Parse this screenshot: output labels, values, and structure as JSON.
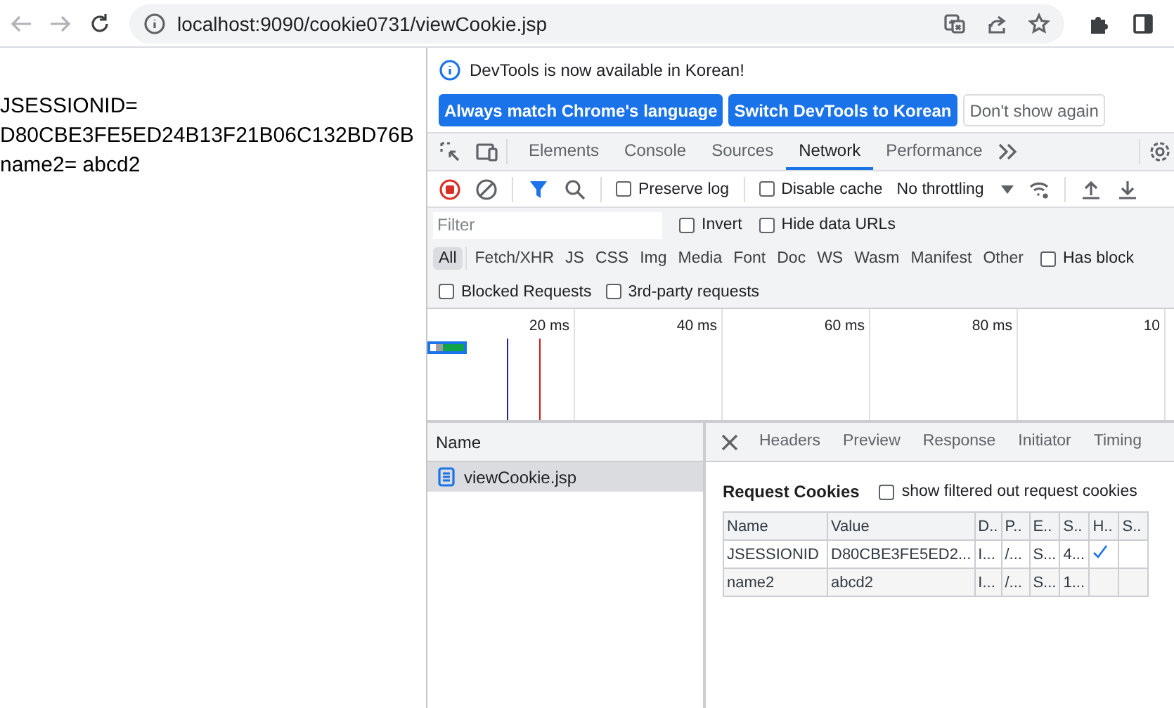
{
  "browser": {
    "url": "localhost:9090/cookie0731/viewCookie.jsp"
  },
  "page": {
    "lines": [
      "JSESSIONID=",
      "D80CBE3FE5ED24B13F21B06C132BD76B",
      "name2= abcd2"
    ]
  },
  "devtools": {
    "infobar": {
      "message": "DevTools is now available in Korean!",
      "buttons": [
        {
          "label": "Always match Chrome's language",
          "kind": "primary"
        },
        {
          "label": "Switch DevTools to Korean",
          "kind": "primary"
        },
        {
          "label": "Don't show again",
          "kind": "secondary"
        }
      ]
    },
    "tabs": [
      {
        "label": "Elements",
        "selected": false
      },
      {
        "label": "Console",
        "selected": false
      },
      {
        "label": "Sources",
        "selected": false
      },
      {
        "label": "Network",
        "selected": true
      },
      {
        "label": "Performance",
        "selected": false
      }
    ],
    "toolbar": {
      "recording": true,
      "options": [
        {
          "label": "Preserve log",
          "checked": false
        },
        {
          "label": "Disable cache",
          "checked": false
        }
      ],
      "throttling": "No throttling"
    },
    "filter": {
      "placeholder": "Filter",
      "options": [
        {
          "label": "Invert",
          "checked": false
        },
        {
          "label": "Hide data URLs",
          "checked": false
        }
      ]
    },
    "type_filters": [
      {
        "label": "All",
        "selected": true
      },
      {
        "label": "Fetch/XHR",
        "selected": false
      },
      {
        "label": "JS",
        "selected": false
      },
      {
        "label": "CSS",
        "selected": false
      },
      {
        "label": "Img",
        "selected": false
      },
      {
        "label": "Media",
        "selected": false
      },
      {
        "label": "Font",
        "selected": false
      },
      {
        "label": "Doc",
        "selected": false
      },
      {
        "label": "WS",
        "selected": false
      },
      {
        "label": "Wasm",
        "selected": false
      },
      {
        "label": "Manifest",
        "selected": false
      },
      {
        "label": "Other",
        "selected": false
      }
    ],
    "has_blocked": {
      "label": "Has block",
      "checked": false
    },
    "more_filters": [
      {
        "label": "Blocked Requests",
        "checked": false
      },
      {
        "label": "3rd-party requests",
        "checked": false
      }
    ],
    "timeline": {
      "ticks": [
        "20 ms",
        "40 ms",
        "60 ms",
        "80 ms",
        "10"
      ]
    },
    "requests": {
      "column": "Name",
      "rows": [
        {
          "name": "viewCookie.jsp",
          "selected": true
        }
      ]
    },
    "detail_tabs": [
      {
        "label": "Headers",
        "selected": false
      },
      {
        "label": "Preview",
        "selected": false
      },
      {
        "label": "Response",
        "selected": false
      },
      {
        "label": "Initiator",
        "selected": false
      },
      {
        "label": "Timing",
        "selected": false
      }
    ],
    "cookies": {
      "title": "Request Cookies",
      "show_filtered": {
        "label": "show filtered out request cookies",
        "checked": false
      },
      "columns": [
        "Name",
        "Value",
        "D..",
        "P..",
        "E..",
        "S..",
        "H..",
        "S.."
      ],
      "rows": [
        {
          "cells": [
            "JSESSIONID",
            "D80CBE3FE5ED2...",
            "I...",
            "/...",
            "S...",
            "4..."
          ],
          "http_only": true,
          "secure": false
        },
        {
          "cells": [
            "name2",
            "abcd2",
            "I...",
            "/...",
            "S...",
            "1..."
          ],
          "http_only": false,
          "secure": false
        }
      ]
    }
  }
}
